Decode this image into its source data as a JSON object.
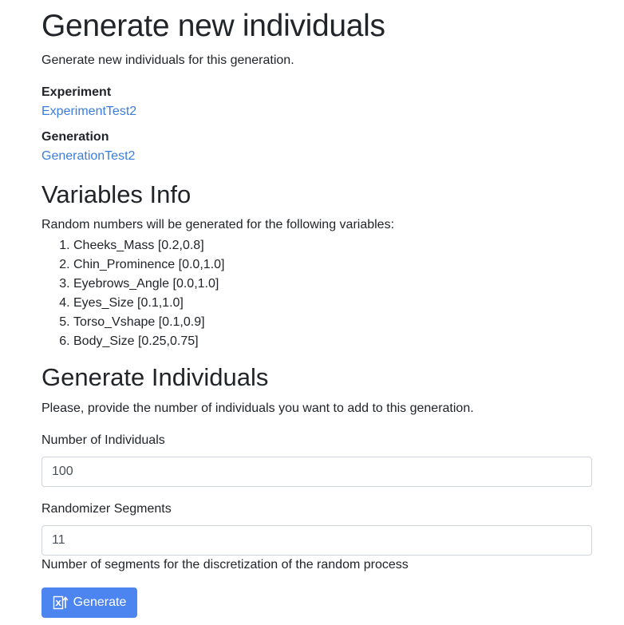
{
  "header": {
    "title": "Generate new individuals",
    "subtitle": "Generate new individuals for this generation."
  },
  "experiment": {
    "label": "Experiment",
    "link_text": "ExperimentTest2"
  },
  "generation": {
    "label": "Generation",
    "link_text": "GenerationTest2"
  },
  "variables_info": {
    "title": "Variables Info",
    "intro": "Random numbers will be generated for the following variables:",
    "items": [
      "Cheeks_Mass [0.2,0.8]",
      "Chin_Prominence [0.0,1.0]",
      "Eyebrows_Angle [0.0,1.0]",
      "Eyes_Size [0.1,1.0]",
      "Torso_Vshape [0.1,0.9]",
      "Body_Size [0.25,0.75]"
    ]
  },
  "generate_individuals": {
    "title": "Generate Individuals",
    "intro": "Please, provide the number of individuals you want to add to this generation.",
    "num_individuals_label": "Number of Individuals",
    "num_individuals_value": "100",
    "segments_label": "Randomizer Segments",
    "segments_value": "11",
    "segments_help": "Number of segments for the discretization of the random process",
    "button_label": "Generate",
    "button_icon": "spreadsheet-upload-icon"
  },
  "colors": {
    "link": "#3b7ddd",
    "primary_button": "#4c84f0",
    "text": "#212529"
  }
}
